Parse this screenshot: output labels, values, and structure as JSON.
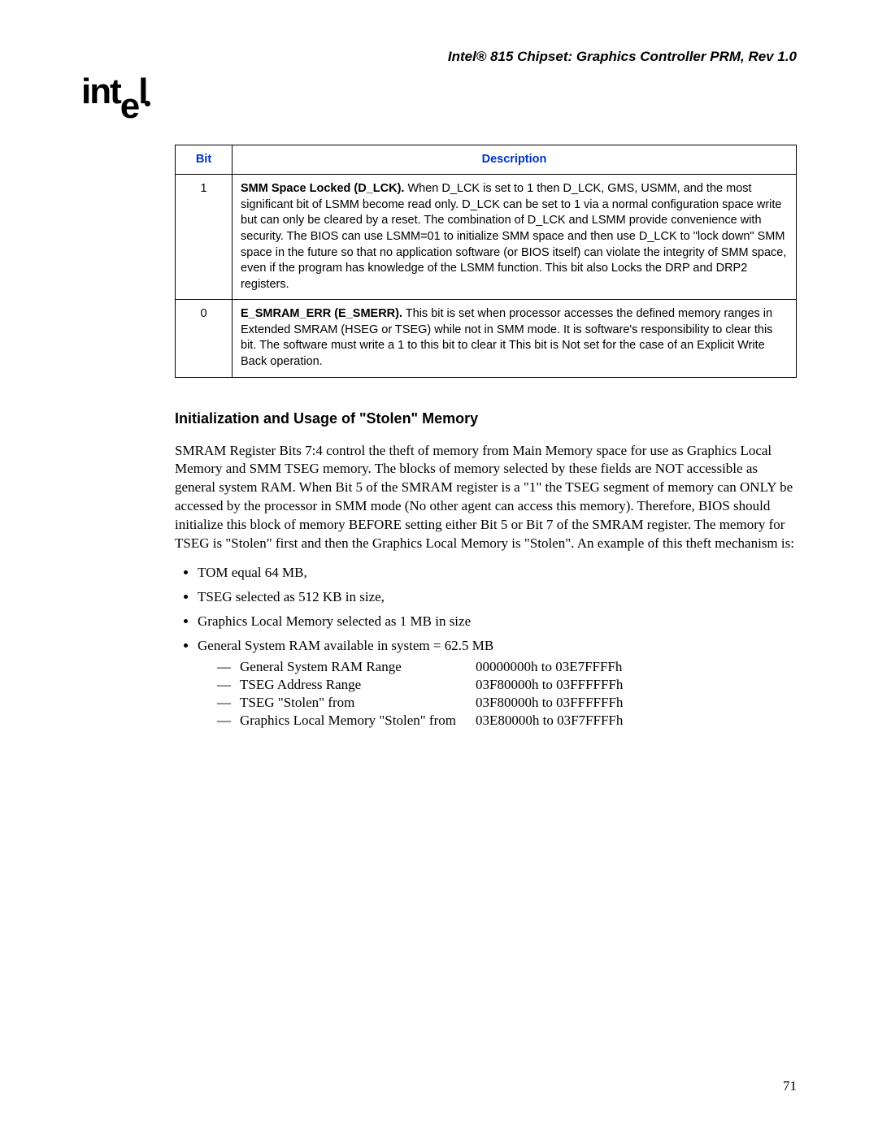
{
  "header": {
    "doc_title": "Intel® 815 Chipset: Graphics Controller PRM, Rev 1.0",
    "logo_text": "intel"
  },
  "table": {
    "headers": {
      "bit": "Bit",
      "desc": "Description"
    },
    "rows": [
      {
        "bit": "1",
        "desc_strong": "SMM Space Locked (D_LCK).",
        "desc_rest": " When D_LCK is set to 1 then D_LCK, GMS, USMM, and the most significant bit of LSMM become read only. D_LCK can be set to 1 via a normal configuration space write but can only be cleared by a reset. The combination of D_LCK and LSMM provide convenience with security. The BIOS can use LSMM=01 to initialize SMM space and then use D_LCK to \"lock down\" SMM space in the future so that no application software (or BIOS itself) can violate the integrity of SMM space, even if the program has knowledge of the LSMM function. This bit also Locks the DRP and DRP2 registers."
      },
      {
        "bit": "0",
        "desc_strong": "E_SMRAM_ERR (E_SMERR).",
        "desc_rest": " This bit is set when processor accesses the defined memory ranges in Extended SMRAM (HSEG or TSEG) while not in SMM mode. It is software's responsibility to clear this bit. The software must write a 1 to this bit to clear it This bit is Not set for the case of an Explicit Write Back operation."
      }
    ]
  },
  "section": {
    "heading": "Initialization and Usage of \"Stolen\" Memory",
    "para": "SMRAM Register Bits 7:4 control the theft of memory from Main Memory space for use as Graphics Local Memory and SMM TSEG memory. The blocks of memory selected by these fields are NOT accessible as general system RAM. When Bit 5 of the SMRAM register is a \"1\" the TSEG segment of memory can ONLY be accessed by the processor in SMM mode (No other agent can access this memory). Therefore, BIOS should initialize this block of memory BEFORE setting either Bit 5 or Bit 7 of the SMRAM register. The memory for TSEG is \"Stolen\" first and then the Graphics Local Memory is \"Stolen\". An example of this theft mechanism is:",
    "bullets": [
      "TOM equal 64 MB,",
      "TSEG selected as 512 KB in size,",
      "Graphics Local Memory selected as 1 MB in size"
    ],
    "last_bullet": "General System RAM available in system = 62.5 MB",
    "sublist": [
      {
        "label": "General System RAM Range",
        "value": "00000000h to 03E7FFFFh"
      },
      {
        "label": "TSEG Address Range",
        "value": "03F80000h to 03FFFFFFh"
      },
      {
        "label": "TSEG \"Stolen\" from",
        "value": "03F80000h to 03FFFFFFh"
      },
      {
        "label": "Graphics Local Memory \"Stolen\" from",
        "value": "03E80000h to 03F7FFFFh"
      }
    ]
  },
  "page_number": "71"
}
